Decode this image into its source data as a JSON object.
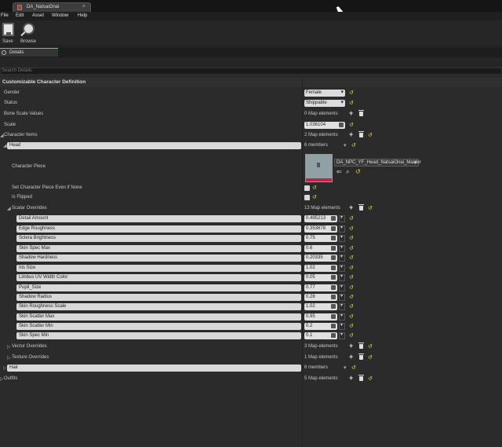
{
  "window": {
    "tab_title": "DA_NatsaiOnai",
    "close_glyph": "×"
  },
  "menu": [
    "File",
    "Edit",
    "Asset",
    "Window",
    "Help"
  ],
  "toolbar": {
    "save_label": "Save",
    "browse_label": "Browse"
  },
  "details_tab": {
    "label": "Details"
  },
  "search": {
    "placeholder": "Search Details"
  },
  "category": {
    "label": "Customizable Character Definition"
  },
  "properties": {
    "gender": {
      "label": "Gender",
      "value": "Female"
    },
    "status": {
      "label": "Status",
      "value": "Shippable"
    },
    "bone_scale": {
      "label": "Bone Scale Values",
      "value": "0 Map elements"
    },
    "scale": {
      "label": "Scale",
      "value": "1.036104"
    },
    "character_items": {
      "label": "Character Items",
      "value": "2 Map elements"
    },
    "head": {
      "label": "Head",
      "value": "6 members"
    },
    "character_piece": {
      "label": "Character Piece",
      "asset": "DA_NPC_YF_Head_NatsaiOnai_Master"
    },
    "set_piece_if_none": {
      "label": "Set Character Piece Even if None"
    },
    "is_flipped": {
      "label": "Is Flipped"
    },
    "scalar_overrides": {
      "label": "Scalar Overrides",
      "value": "13 Map elements"
    },
    "vector_overrides": {
      "label": "Vector Overrides",
      "value": "3 Map elements"
    },
    "texture_overrides": {
      "label": "Texture Overrides",
      "value": "1 Map elements"
    },
    "hair": {
      "label": "Hair",
      "value": "6 members"
    },
    "outfits": {
      "label": "Outfits",
      "value": "5 Map elements"
    }
  },
  "scalars": [
    {
      "name": "Detail Amount",
      "value": "0.495213"
    },
    {
      "name": "Edge Roughness",
      "value": "0.353678"
    },
    {
      "name": "Sclera Brightness",
      "value": "0.75"
    },
    {
      "name": "Skin Spec Max",
      "value": "0.6"
    },
    {
      "name": "Shadow Hardness",
      "value": "0.20335"
    },
    {
      "name": "Iris Size",
      "value": "1.02"
    },
    {
      "name": "Limbus UV Width Color",
      "value": "0.05"
    },
    {
      "name": "Pupil_Size",
      "value": "0.77"
    },
    {
      "name": "Shadow Radius",
      "value": "0.28"
    },
    {
      "name": "Skin Roughness Scale",
      "value": "1.02"
    },
    {
      "name": "Skin Scatter Max",
      "value": "0.95"
    },
    {
      "name": "Skin Scatter Min",
      "value": "0.2"
    },
    {
      "name": "Skin Spec Min",
      "value": "0.1"
    }
  ]
}
